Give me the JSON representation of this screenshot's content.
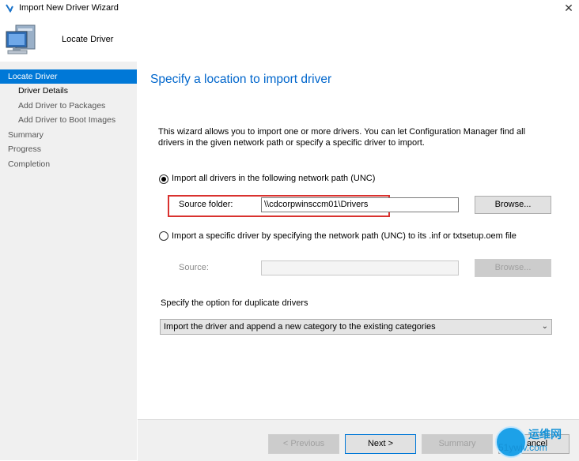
{
  "window": {
    "title": "Import New Driver Wizard",
    "close_glyph": "✕"
  },
  "header": {
    "title": "Locate Driver"
  },
  "nav": {
    "items": [
      {
        "label": "Locate Driver"
      },
      {
        "label": "Driver Details"
      },
      {
        "label": "Add Driver to Packages"
      },
      {
        "label": "Add Driver to Boot Images"
      },
      {
        "label": "Summary"
      },
      {
        "label": "Progress"
      },
      {
        "label": "Completion"
      }
    ]
  },
  "main": {
    "title": "Specify a location to import driver",
    "description": "This wizard allows you to import one or more drivers. You can let Configuration Manager find all drivers in the given network path or specify a specific driver to import.",
    "option_unc": {
      "label": "Import all drivers in the following network path (UNC)",
      "checked": true
    },
    "source_folder": {
      "label": "Source folder:",
      "value": "\\\\cdcorpwinsccm01\\Drivers"
    },
    "browse_label": "Browse...",
    "option_specific": {
      "label": "Import a specific driver by specifying the network path (UNC) to its .inf or txtsetup.oem file",
      "checked": false
    },
    "source": {
      "label": "Source:",
      "value": ""
    },
    "browse2_label": "Browse...",
    "duplicate_label": "Specify the option for duplicate drivers",
    "duplicate_selected": "Import the driver and append a new category to the existing categories"
  },
  "footer": {
    "previous": "< Previous",
    "next": "Next >",
    "summary": "Summary",
    "cancel": "Cancel"
  },
  "watermark": {
    "top": "运维网",
    "bottom": "51ywjv.com"
  },
  "colors": {
    "accent": "#0078d7",
    "title": "#0066cc",
    "highlight": "#d9322f"
  },
  "icons": {
    "title": "arrow-icon",
    "header": "computer-icon"
  }
}
